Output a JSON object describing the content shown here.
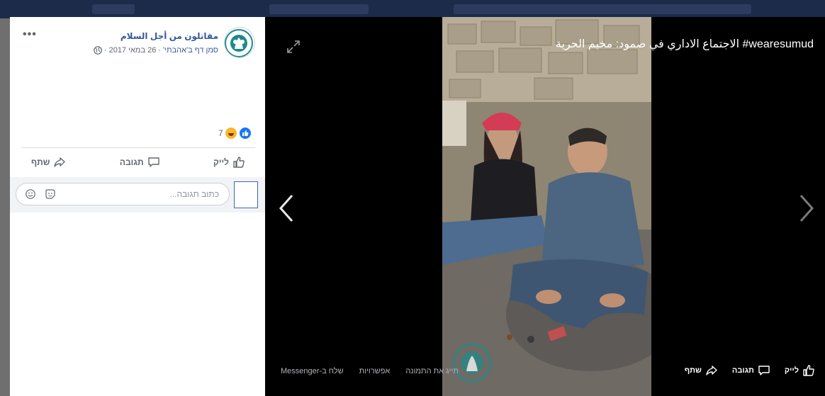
{
  "post": {
    "page_name": "مقاتلون من أجل السلام",
    "location_link": "סמן דף ב'אהבתי'",
    "date": "26 במאי 2017",
    "separator": "·",
    "privacy_icon": "globe-icon",
    "more_icon": "more-dots-icon",
    "more_label": "•••",
    "reaction_count": "7",
    "reaction_icons": [
      "like-reaction-icon",
      "haha-reaction-icon"
    ]
  },
  "actions": {
    "like": "לייק",
    "comment": "תגובה",
    "share": "שתף"
  },
  "comment_box": {
    "placeholder": "כתוב תגובה...",
    "value": ""
  },
  "viewer": {
    "caption": "الاجتماع الاداري في صمود: مخيم الحرية #wearesumud",
    "tag_photo": "תייג את התמונה",
    "options": "אפשרויות",
    "send_messenger": "שלח ב-Messenger",
    "footer_like": "לייק",
    "footer_comment": "תגובה",
    "footer_share": "שתף"
  },
  "colors": {
    "brand_blue": "#385898",
    "like_blue": "#1877f2",
    "viewer_bg": "#000000",
    "panel_bg": "#ffffff"
  }
}
